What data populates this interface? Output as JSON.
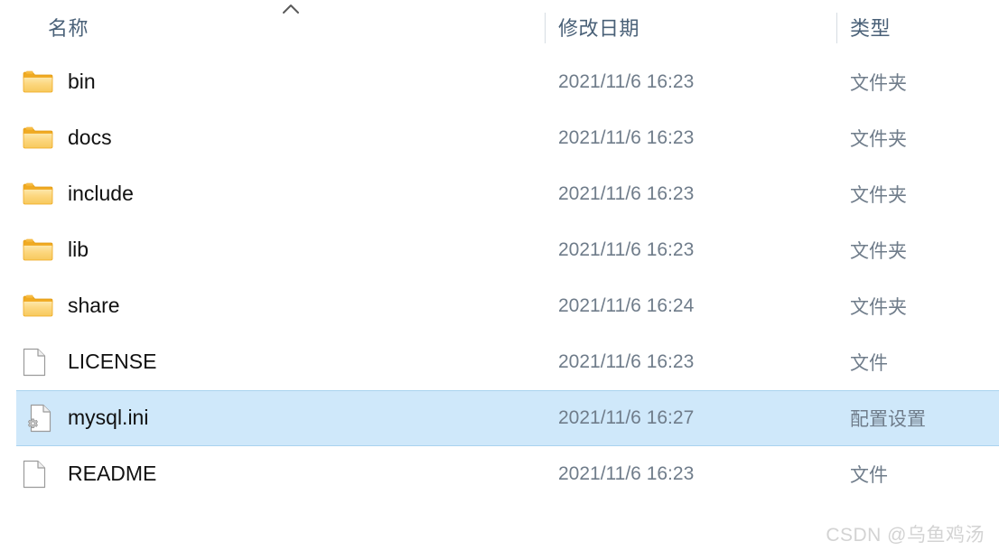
{
  "columns": {
    "name_label": "名称",
    "date_label": "修改日期",
    "type_label": "类型",
    "sort_icon": "chevron-up-icon",
    "sorted_by": "名称"
  },
  "files": [
    {
      "name": "bin",
      "date": "2021/11/6 16:23",
      "type": "文件夹",
      "icon": "folder-icon",
      "selected": false
    },
    {
      "name": "docs",
      "date": "2021/11/6 16:23",
      "type": "文件夹",
      "icon": "folder-icon",
      "selected": false
    },
    {
      "name": "include",
      "date": "2021/11/6 16:23",
      "type": "文件夹",
      "icon": "folder-icon",
      "selected": false
    },
    {
      "name": "lib",
      "date": "2021/11/6 16:23",
      "type": "文件夹",
      "icon": "folder-icon",
      "selected": false
    },
    {
      "name": "share",
      "date": "2021/11/6 16:24",
      "type": "文件夹",
      "icon": "folder-icon",
      "selected": false
    },
    {
      "name": "LICENSE",
      "date": "2021/11/6 16:23",
      "type": "文件",
      "icon": "blank-document-icon",
      "selected": false
    },
    {
      "name": "mysql.ini",
      "date": "2021/11/6 16:27",
      "type": "配置设置",
      "icon": "config-document-icon",
      "selected": true
    },
    {
      "name": "README",
      "date": "2021/11/6 16:23",
      "type": "文件",
      "icon": "blank-document-icon",
      "selected": false
    }
  ],
  "watermark": {
    "text": "CSDN @乌鱼鸡汤"
  },
  "colors": {
    "selection_fill": "#cfe8fa",
    "selection_border": "#a9d3ef",
    "header_text": "#4a6178",
    "secondary_text": "#6f7c8a",
    "primary_text": "#111111",
    "folder_body": "#fcd77f",
    "folder_edge": "#efa81d",
    "watermark": "#d3d3d3"
  }
}
